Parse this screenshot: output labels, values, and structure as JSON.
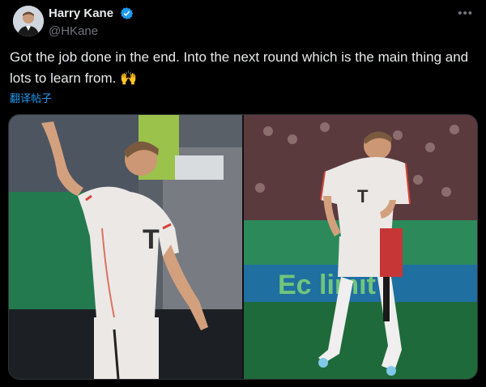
{
  "author": {
    "display_name": "Harry Kane",
    "handle": "@HKane",
    "verified_color": "#1d9bf0"
  },
  "more_icon": "•••",
  "tweet": {
    "text": "Got the job done in the end. Into the next round which is the main thing and lots to learn from. 🙌",
    "translate_label": "翻译帖子"
  },
  "media": {
    "right_photo_banner_text": "Ec     limit"
  },
  "colors": {
    "background": "#000000",
    "text": "#e7e9ea",
    "muted": "#71767b",
    "link": "#1d9bf0"
  }
}
